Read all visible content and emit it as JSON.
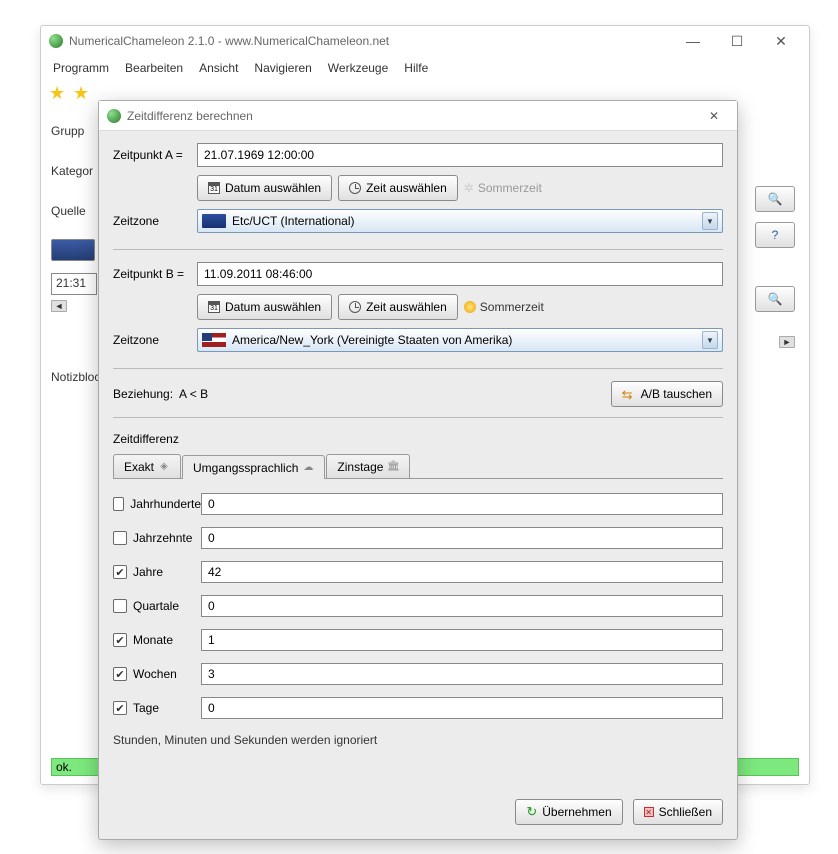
{
  "main": {
    "title": "NumericalChameleon 2.1.0 - www.NumericalChameleon.net",
    "menu": [
      "Programm",
      "Bearbeiten",
      "Ansicht",
      "Navigieren",
      "Werkzeuge",
      "Hilfe"
    ],
    "labels": {
      "gruppe": "Grupp",
      "kategorie": "Kategor",
      "quelle": "Quelle",
      "notiz": "Notizbloc"
    },
    "time_value": "21:31",
    "status": "ok."
  },
  "dialog": {
    "title": "Zeitdifferenz berechnen",
    "a": {
      "label": "Zeitpunkt A =",
      "value": "21.07.1969 12:00:00",
      "tz_label": "Zeitzone",
      "tz_value": "Etc/UCT (International)",
      "sommer": "Sommerzeit",
      "sommer_active": false
    },
    "b": {
      "label": "Zeitpunkt B =",
      "value": "11.09.2011 08:46:00",
      "tz_label": "Zeitzone",
      "tz_value": "America/New_York (Vereinigte Staaten von Amerika)",
      "sommer": "Sommerzeit",
      "sommer_active": true
    },
    "btn_date": "Datum auswählen",
    "btn_time": "Zeit auswählen",
    "relation_label": "Beziehung:",
    "relation_value": "A < B",
    "swap_label": "A/B tauschen",
    "diff_label": "Zeitdifferenz",
    "tabs": [
      "Exakt",
      "Umgangssprachlich",
      "Zinstage"
    ],
    "units": [
      {
        "label": "Jahrhunderte",
        "checked": false,
        "value": "0"
      },
      {
        "label": "Jahrzehnte",
        "checked": false,
        "value": "0"
      },
      {
        "label": "Jahre",
        "checked": true,
        "value": "42"
      },
      {
        "label": "Quartale",
        "checked": false,
        "value": "0"
      },
      {
        "label": "Monate",
        "checked": true,
        "value": "1"
      },
      {
        "label": "Wochen",
        "checked": true,
        "value": "3"
      },
      {
        "label": "Tage",
        "checked": true,
        "value": "0"
      }
    ],
    "note": "Stunden, Minuten und Sekunden werden ignoriert",
    "apply": "Übernehmen",
    "close": "Schließen"
  }
}
